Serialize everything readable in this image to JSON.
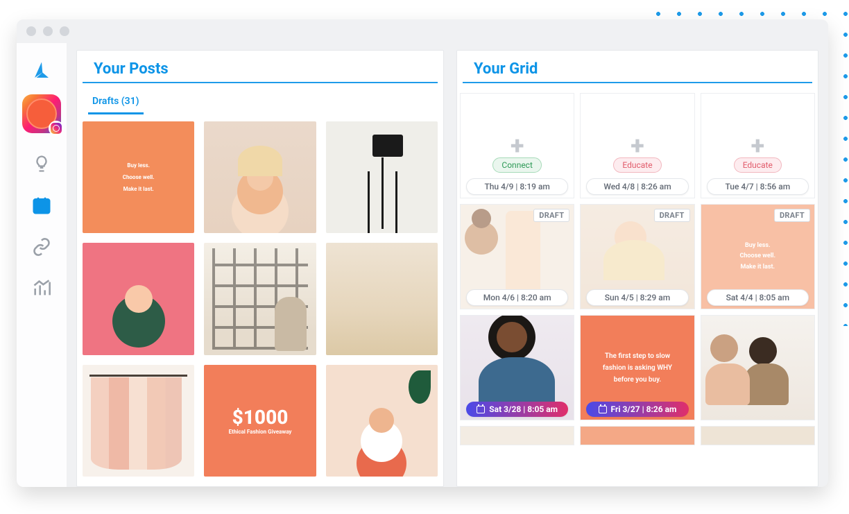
{
  "panels": {
    "posts": {
      "title": "Your Posts",
      "tab": "Drafts (31)"
    },
    "grid": {
      "title": "Your Grid"
    }
  },
  "quote1": {
    "l1": "Buy less.",
    "l2": "Choose well.",
    "l3": "Make it last."
  },
  "price": {
    "amount": "$1000",
    "sub": "Ethical Fashion Giveaway"
  },
  "gridLabels": {
    "draft": "DRAFT",
    "connect": "Connect",
    "educate": "Educate"
  },
  "gridCells": {
    "c1_time": "Thu 4/9 | 8:19 am",
    "c2_time": "Wed 4/8 | 8:26 am",
    "c3_time": "Tue 4/7 | 8:56 am",
    "c4_time": "Mon 4/6 | 8:20 am",
    "c5_time": "Sun 4/5 | 8:29 am",
    "c6_time": "Sat 4/4 | 8:05 am",
    "c7_time": "Sat 3/28 | 8:05 am",
    "c8_time": "Fri 3/27 | 8:26 am",
    "c8_text": "The first step to slow fashion is asking WHY before you buy."
  }
}
